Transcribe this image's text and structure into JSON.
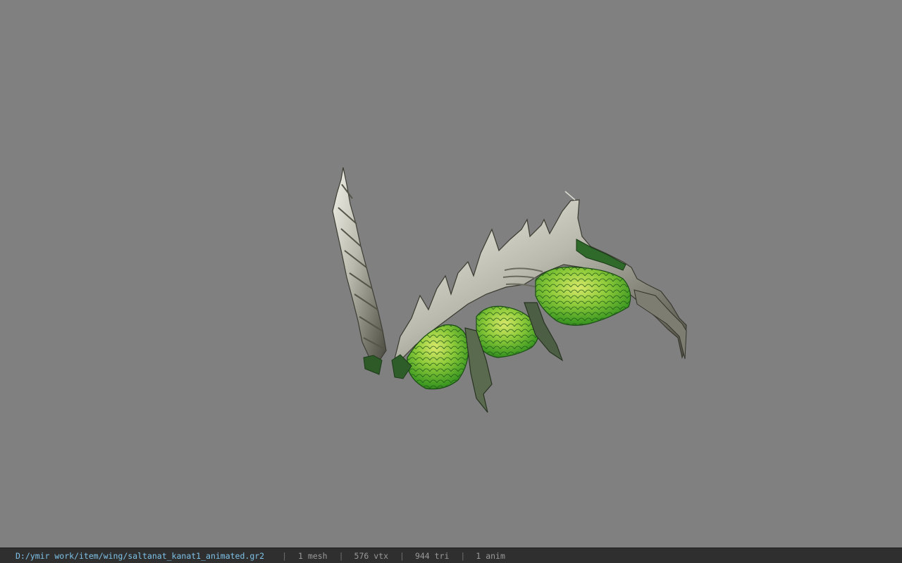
{
  "viewport": {
    "background": "#808080",
    "model": "saltanat_kanat1_animated"
  },
  "statusbar": {
    "path": "D:/ymir work/item/wing/saltanat_kanat1_animated.gr2",
    "separator": "|",
    "mesh": "1 mesh",
    "vtx": "576 vtx",
    "tri": "944 tri",
    "anim": "1 anim",
    "path_color": "#7ec2e8"
  }
}
